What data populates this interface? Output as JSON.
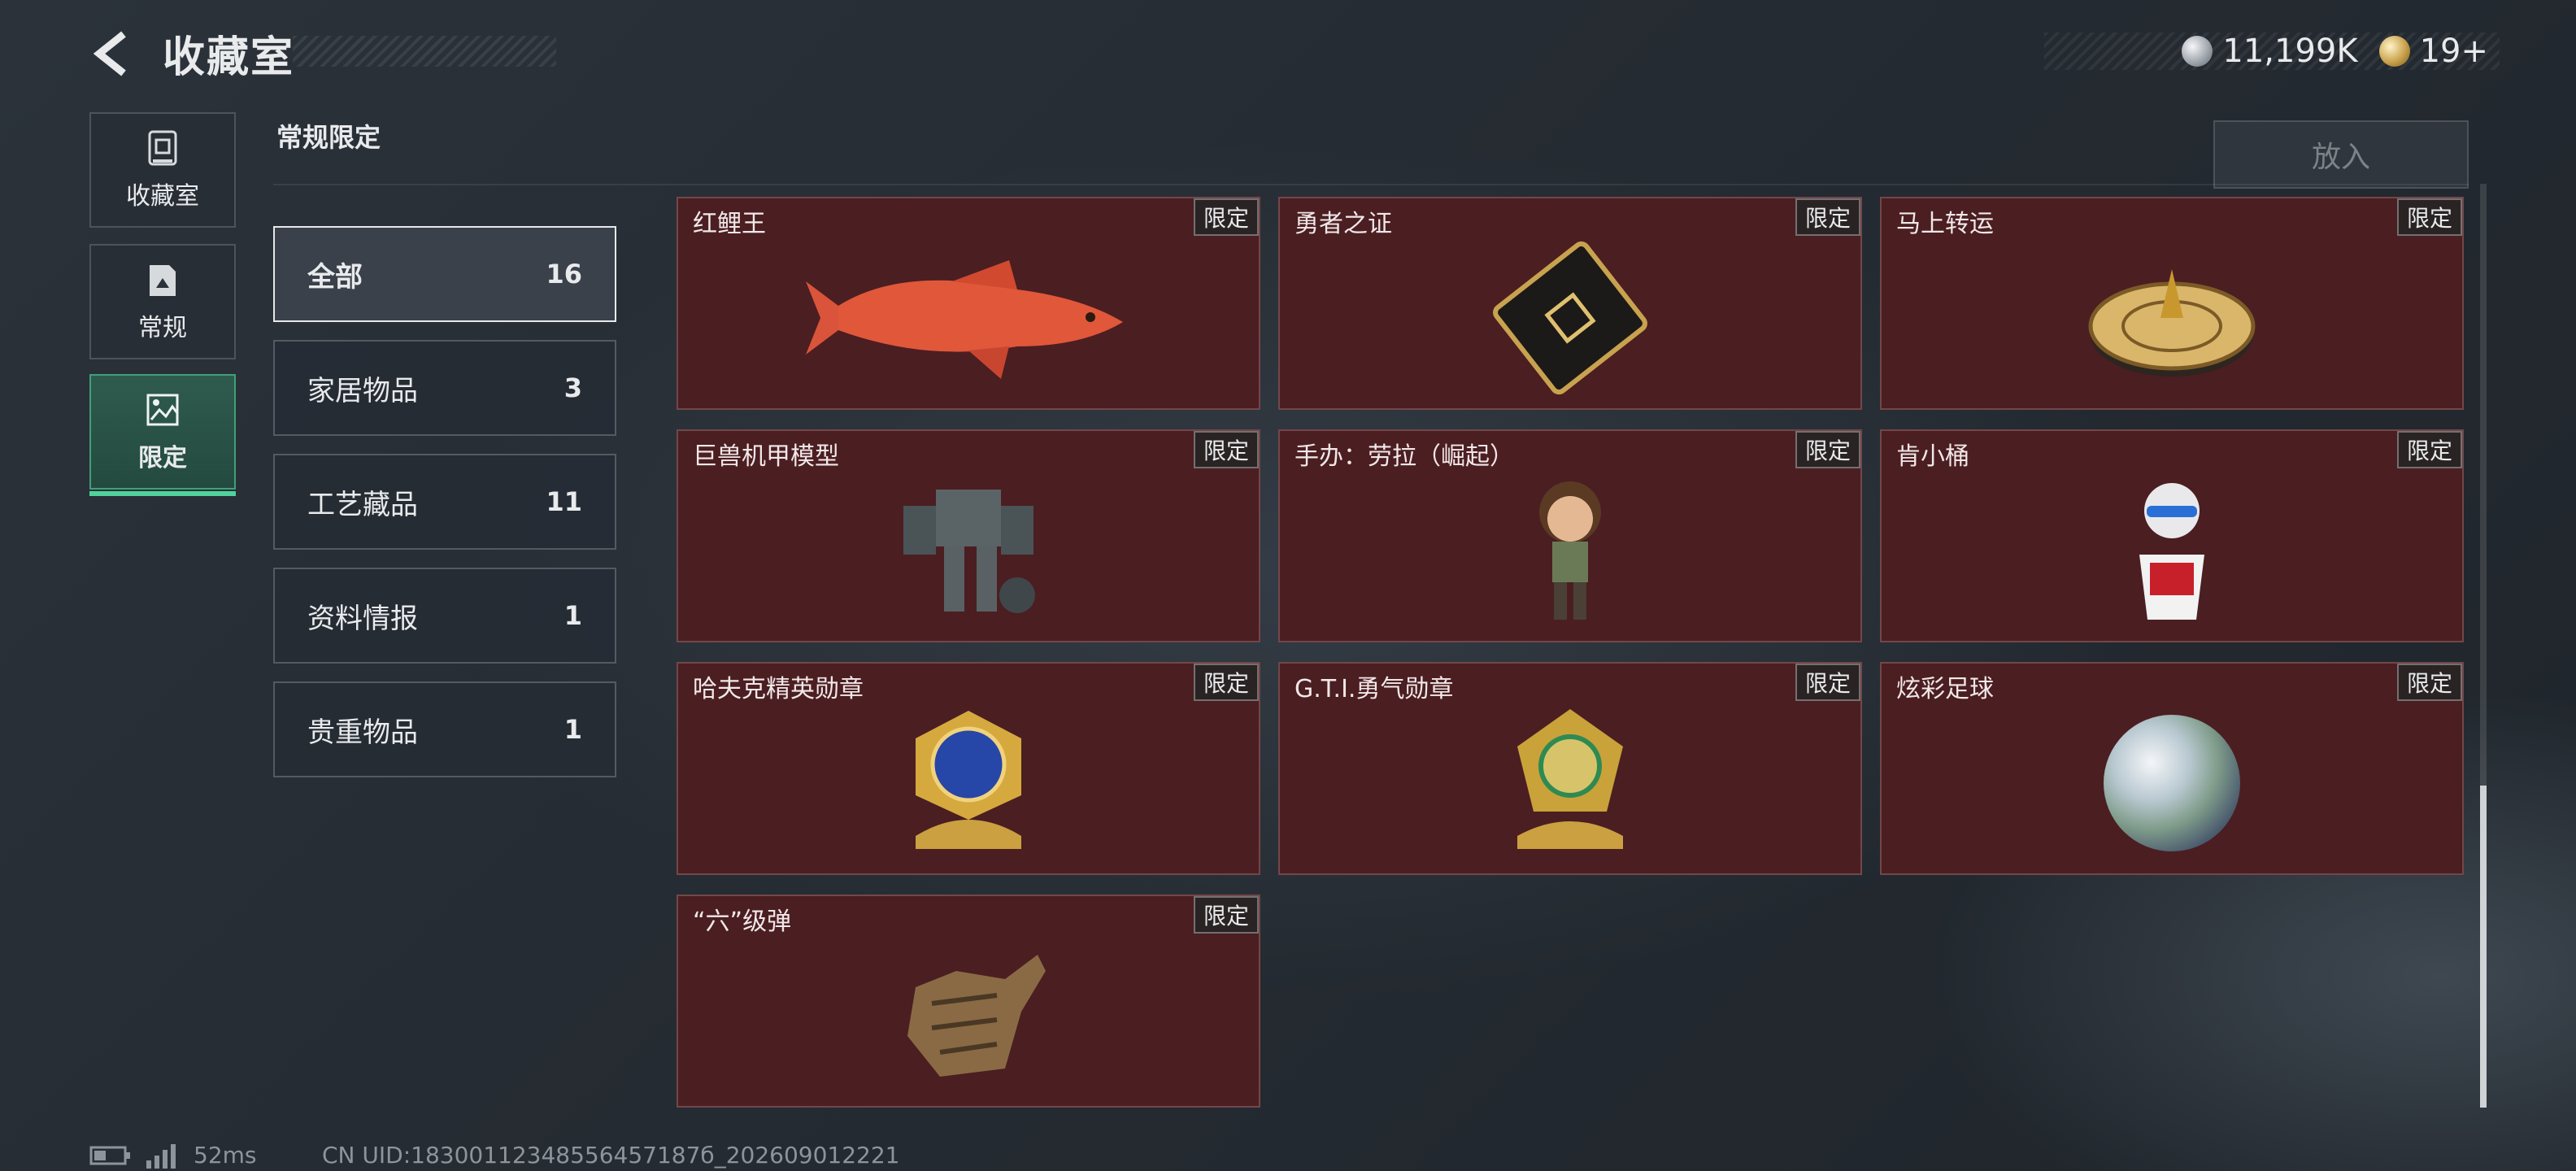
{
  "header": {
    "title": "收藏室",
    "back_icon": "back-arrow-icon"
  },
  "currency": [
    {
      "icon": "silver-coin-icon",
      "value": "11,199K",
      "color": "#b9bec5"
    },
    {
      "icon": "gold-coin-icon",
      "value": "19+",
      "color": "#c9a24c"
    }
  ],
  "nav": [
    {
      "label": "收藏室",
      "icon": "vault-icon"
    },
    {
      "label": "常规",
      "icon": "document-icon"
    },
    {
      "label": "限定",
      "icon": "image-icon",
      "active": true
    }
  ],
  "section_title": "常规限定",
  "put_button": "放入",
  "categories": [
    {
      "label": "全部",
      "count": "16",
      "active": true
    },
    {
      "label": "家居物品",
      "count": "3"
    },
    {
      "label": "工艺藏品",
      "count": "11"
    },
    {
      "label": "资料情报",
      "count": "1"
    },
    {
      "label": "贵重物品",
      "count": "1"
    }
  ],
  "items": [
    {
      "name": "红鲤王",
      "tag": "限定",
      "art": "fish"
    },
    {
      "name": "勇者之证",
      "tag": "限定",
      "art": "card"
    },
    {
      "name": "马上转运",
      "tag": "限定",
      "art": "wheel"
    },
    {
      "name": "巨兽机甲模型",
      "tag": "限定",
      "art": "mech"
    },
    {
      "name": "手办：劳拉（崛起）",
      "tag": "限定",
      "art": "figure"
    },
    {
      "name": "肯小桶",
      "tag": "限定",
      "art": "bucket"
    },
    {
      "name": "哈夫克精英勋章",
      "tag": "限定",
      "art": "medal-blue"
    },
    {
      "name": "G.T.I.勇气勋章",
      "tag": "限定",
      "art": "medal-green"
    },
    {
      "name": "炫彩足球",
      "tag": "限定",
      "art": "orb"
    },
    {
      "name": "“六”级弹",
      "tag": "限定",
      "art": "hand"
    }
  ],
  "footer": {
    "ping": "52ms",
    "uid": "CN UID:18300112348556457187б_202609012221"
  },
  "colors": {
    "card_bg": "#4b1e22",
    "active_nav": "#2f5b4e",
    "accent": "#4fd39a"
  }
}
